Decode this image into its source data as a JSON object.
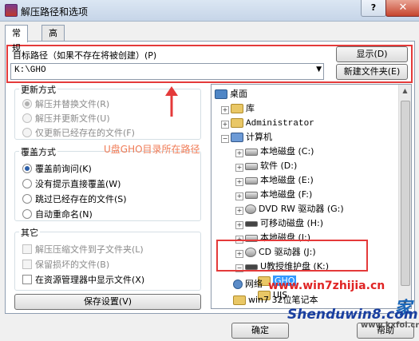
{
  "window": {
    "title": "解压路径和选项",
    "help_button": "?",
    "close_button": "✕"
  },
  "tabs": [
    {
      "label": "常规",
      "active": true
    },
    {
      "label": "高级",
      "active": false
    }
  ],
  "target_path": {
    "label": "目标路径（如果不存在将被创建）(P)",
    "value": "K:\\GHO",
    "show_button": "显示(D)",
    "new_folder_button": "新建文件夹(E)"
  },
  "update_mode": {
    "title": "更新方式",
    "options": [
      {
        "label": "解压并替换文件(R)",
        "selected": true,
        "enabled": false
      },
      {
        "label": "解压并更新文件(U)",
        "selected": false,
        "enabled": false
      },
      {
        "label": "仅更新已经存在的文件(F)",
        "selected": false,
        "enabled": false
      }
    ]
  },
  "overwrite_mode": {
    "title": "覆盖方式",
    "options": [
      {
        "label": "覆盖前询问(K)",
        "selected": true
      },
      {
        "label": "没有提示直接覆盖(W)",
        "selected": false
      },
      {
        "label": "跳过已经存在的文件(S)",
        "selected": false
      },
      {
        "label": "自动重命名(N)",
        "selected": false
      }
    ]
  },
  "misc": {
    "title": "其它",
    "options": [
      {
        "label": "解压压缩文件到子文件夹(L)",
        "enabled": false
      },
      {
        "label": "保留损坏的文件(B)",
        "enabled": false
      },
      {
        "label": "在资源管理器中显示文件(X)",
        "enabled": true
      }
    ],
    "save_button": "保存设置(V)"
  },
  "tree": {
    "items": [
      {
        "label": "桌面",
        "icon": "desktop-icon"
      },
      {
        "label": "库",
        "icon": "folder-icon"
      },
      {
        "label": "Administrator",
        "icon": "user-folder-icon"
      },
      {
        "label": "计算机",
        "icon": "computer-icon"
      },
      {
        "label": "本地磁盘 (C:)",
        "icon": "drive-icon"
      },
      {
        "label": "软件 (D:)",
        "icon": "drive-icon"
      },
      {
        "label": "本地磁盘 (E:)",
        "icon": "drive-icon"
      },
      {
        "label": "本地磁盘 (F:)",
        "icon": "drive-icon"
      },
      {
        "label": "DVD RW 驱动器 (G:)",
        "icon": "dvd-icon"
      },
      {
        "label": "可移动磁盘 (H:)",
        "icon": "usb-drive-icon"
      },
      {
        "label": "本地磁盘 (I:)",
        "icon": "drive-icon"
      },
      {
        "label": "CD 驱动器 (J:)",
        "icon": "cd-icon"
      },
      {
        "label": "U教授维护盘 (K:)",
        "icon": "usb-drive-icon"
      },
      {
        "label": "GHO",
        "icon": "folder-icon"
      },
      {
        "label": "UJS",
        "icon": "folder-icon"
      },
      {
        "label": "网络",
        "icon": "network-icon"
      },
      {
        "label": "win7 32位笔记本",
        "icon": "folder-icon"
      }
    ]
  },
  "buttons": {
    "ok": "确定",
    "help": "帮助"
  },
  "annotation": {
    "text": "U盘GHO目录所在路径"
  },
  "watermarks": {
    "line1": "www.win7zhijia.cn",
    "line2": "Shenduwin8.com",
    "line3": "www.kxfoi.cn",
    "cutoff_text": "家"
  },
  "colors": {
    "highlight_red": "#e43a3a",
    "annotation": "#f07b56",
    "selection": "#3399ff"
  }
}
